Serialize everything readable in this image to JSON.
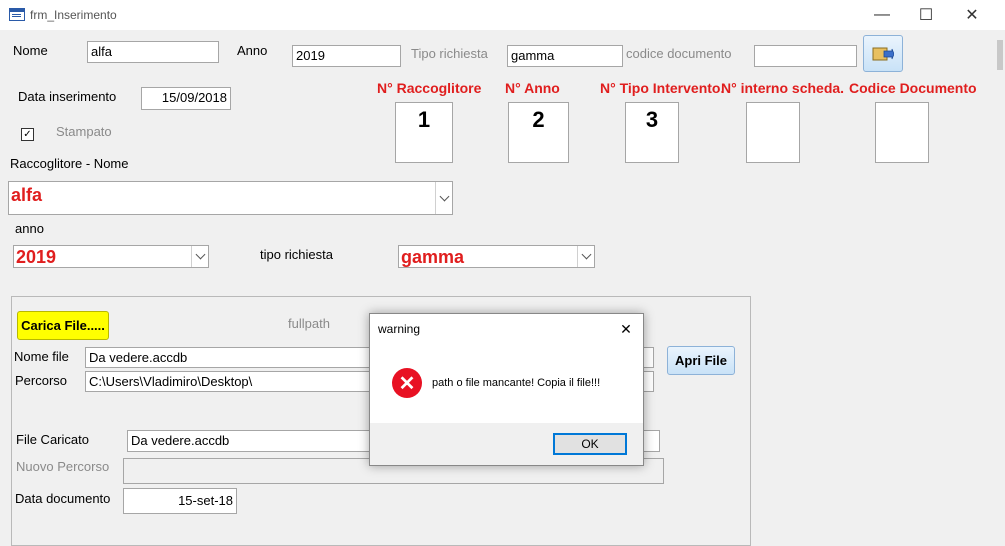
{
  "window": {
    "title": "frm_Inserimento",
    "minimize": "—",
    "maximize": "☐",
    "close": "✕"
  },
  "form": {
    "nome_label": "Nome",
    "nome_value": "alfa",
    "anno_label": "Anno",
    "anno_value": "2019",
    "tipo_richiesta_label": "Tipo richiesta",
    "tipo_richiesta_value": "gamma",
    "codice_documento_label": "codice documento",
    "codice_documento_value": "",
    "data_inserimento_label": "Data inserimento",
    "data_inserimento_value": "15/09/2018",
    "stampato_label": "Stampato",
    "stampato_checked": "✓",
    "raccoglitore_nome_label": "Raccoglitore - Nome",
    "raccoglitore_combo_value": "alfa",
    "anno_combo_label": "anno",
    "anno_combo_value": "2019",
    "tipo_richiesta_combo_label": "tipo richiesta",
    "tipo_richiesta_combo_value": "gamma"
  },
  "codes": {
    "raccoglitore_head": "N° Raccoglitore",
    "raccoglitore_value": "1",
    "anno_head": "N° Anno",
    "anno_value": "2",
    "tipo_intervento_head": "N° Tipo Intervento.",
    "tipo_intervento_value": "3",
    "interno_scheda_head": "N° interno scheda.",
    "interno_scheda_value": "",
    "codice_documento_head": "Codice Documento",
    "codice_documento_value": ""
  },
  "file_panel": {
    "carica_button": "Carica File.....",
    "fullpath_label": "fullpath",
    "nome_file_label": "Nome file",
    "nome_file_value": "Da vedere.accdb",
    "percorso_label": "Percorso",
    "percorso_value": "C:\\Users\\Vladimiro\\Desktop\\",
    "apri_button": "Apri File",
    "file_caricato_label": "File Caricato",
    "file_caricato_value": "Da vedere.accdb",
    "nuovo_percorso_label": "Nuovo Percorso",
    "nuovo_percorso_value": "",
    "data_documento_label": "Data documento",
    "data_documento_value": "15-set-18"
  },
  "dialog": {
    "title": "warning",
    "close": "✕",
    "icon": "error-icon",
    "icon_glyph": "✕",
    "message": "path o file mancante! Copia il file!!!",
    "ok_button": "OK"
  },
  "colors": {
    "accent_red": "#e01e1e",
    "button_yellow": "#ffff00",
    "focus_blue": "#0078d7",
    "error_red": "#e81123"
  }
}
